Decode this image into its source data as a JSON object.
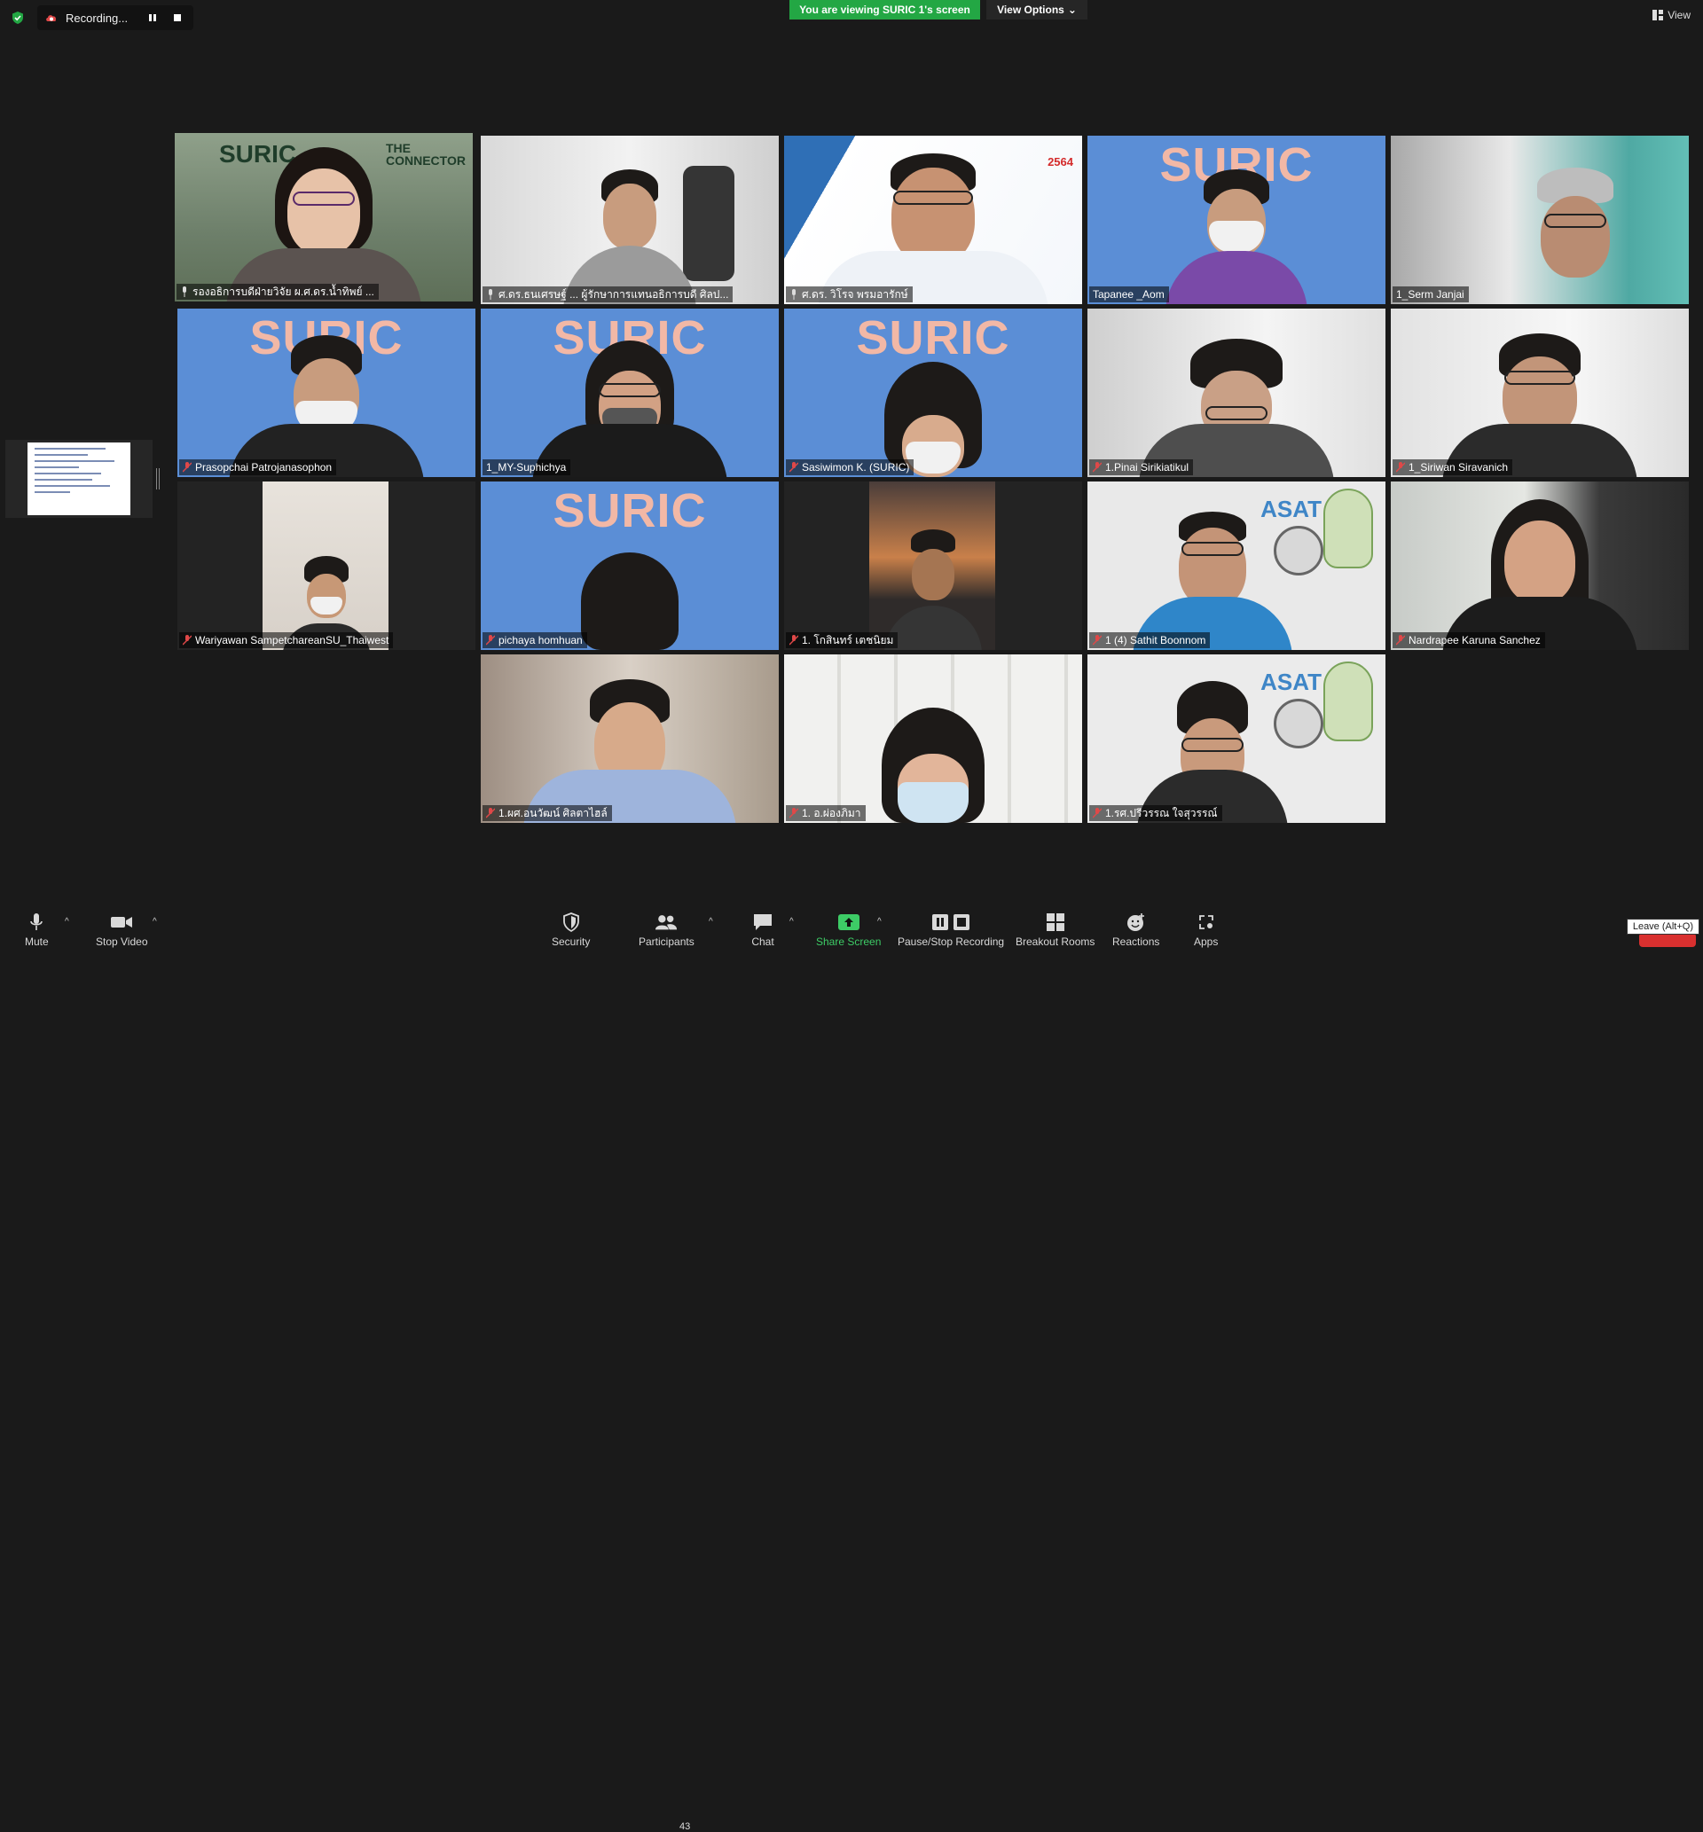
{
  "top_bar": {
    "recording_label": "Recording...",
    "viewing_banner": "You are viewing SURIC 1's screen",
    "view_options_label": "View Options",
    "view_label": "View"
  },
  "participants": [
    {
      "name": "รองอธิการบดีฝ่ายวิจัย ผ.ศ.ดร.น้ำทิพย์ ...",
      "muted": false,
      "pinned_icon": true,
      "active": true
    },
    {
      "name": "ศ.ดร.ธนเศรษฐ์ ... ผู้รักษาการแทนอธิการบดี ศิลป...",
      "muted": false,
      "pinned_icon": true
    },
    {
      "name": "ศ.ดร. วิโรจ พรมอารักษ์",
      "muted": false,
      "pinned_icon": true
    },
    {
      "name": "Tapanee _Aom",
      "muted": false
    },
    {
      "name": "1_Serm Janjai",
      "muted": false
    },
    {
      "name": "Prasopchai Patrojanasophon",
      "muted": true
    },
    {
      "name": "1_MY-Suphichya",
      "muted": false
    },
    {
      "name": "Sasiwimon K. (SURIC)",
      "muted": true
    },
    {
      "name": "1.Pinai Sirikiatikul",
      "muted": true
    },
    {
      "name": "1_Siriwan Siravanich",
      "muted": true
    },
    {
      "name": "Wariyawan SampetchareanSU_Thaiwest",
      "muted": true
    },
    {
      "name": "pichaya homhuan",
      "muted": true
    },
    {
      "name": "1. โกสินทร์ เตชนิยม",
      "muted": true
    },
    {
      "name": "1 (4) Sathit Boonnom",
      "muted": true
    },
    {
      "name": "Nardrapee Karuna Sanchez",
      "muted": true
    },
    {
      "name": "1.ผศ.อนวัฒน์ ศิลตาไฮล์",
      "muted": true
    },
    {
      "name": "1. อ.ผ่องภิมา",
      "muted": true
    },
    {
      "name": "1.รศ.ปรีวรรณ ใจสุวรรณ์",
      "muted": true
    }
  ],
  "tile_text": {
    "suric": "SURIC",
    "suric_connector": "SURIC",
    "connector": "THE CONNECTOR",
    "asat": "ASAT",
    "year_badge": "2564"
  },
  "toolbar": {
    "mute": "Mute",
    "stop_video": "Stop Video",
    "security": "Security",
    "participants": "Participants",
    "participants_count": "43",
    "chat": "Chat",
    "share_screen": "Share Screen",
    "pause_stop_recording": "Pause/Stop Recording",
    "breakout_rooms": "Breakout Rooms",
    "reactions": "Reactions",
    "apps": "Apps",
    "leave_tooltip": "Leave (Alt+Q)"
  },
  "colors": {
    "accent_green": "#23a744",
    "active_speaker": "#e6d36b",
    "suric_blue": "#5b8ed6",
    "muted_red": "#e04848"
  }
}
